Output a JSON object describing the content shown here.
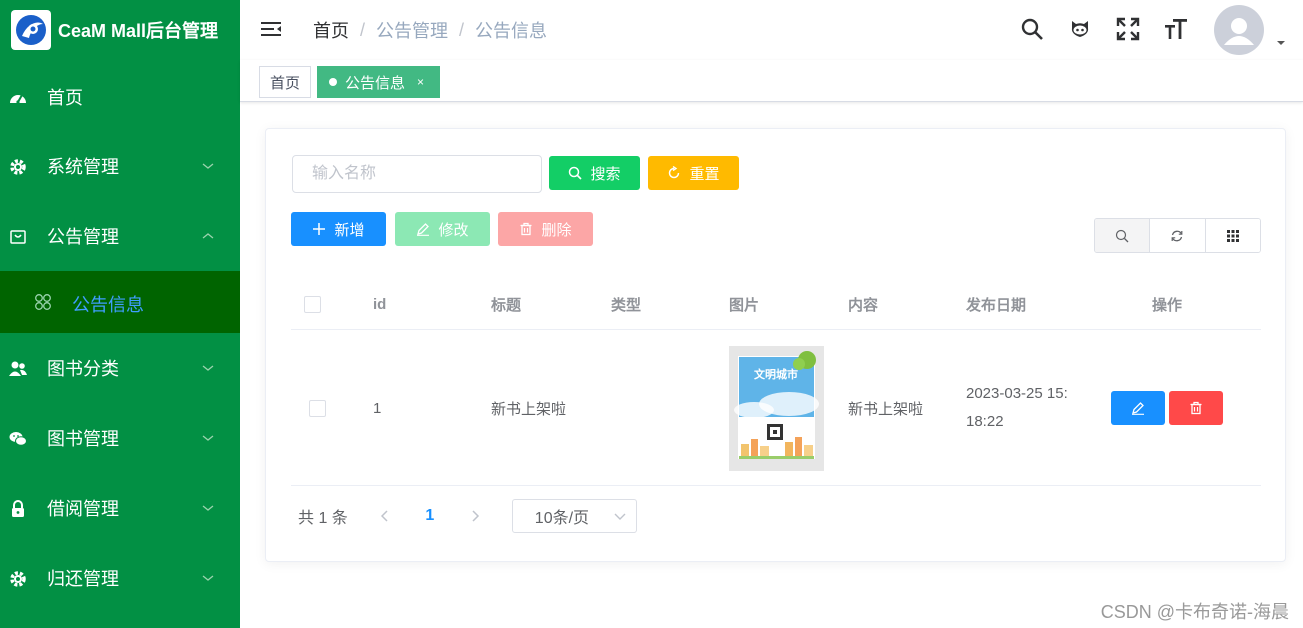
{
  "app": {
    "title": "CeaM Mall后台管理"
  },
  "sidebar": {
    "items": [
      {
        "label": "首页",
        "icon": "dashboard-icon",
        "expandable": false
      },
      {
        "label": "系统管理",
        "icon": "gear-icon",
        "expandable": true
      },
      {
        "label": "公告管理",
        "icon": "notice-box-icon",
        "expandable": true,
        "expanded": true
      },
      {
        "label": "图书分类",
        "icon": "user-group-icon",
        "expandable": true
      },
      {
        "label": "图书管理",
        "icon": "wechat-icon",
        "expandable": true
      },
      {
        "label": "借阅管理",
        "icon": "lock-icon",
        "expandable": true
      },
      {
        "label": "归还管理",
        "icon": "gear-icon",
        "expandable": true
      }
    ],
    "sub_item": {
      "label": "公告信息",
      "icon": "grid-flower-icon"
    },
    "colors": {
      "background": "#029044",
      "active_background": "#006400",
      "active_text": "#409eff"
    }
  },
  "header": {
    "breadcrumb": [
      "首页",
      "公告管理",
      "公告信息"
    ],
    "icons": [
      "search-icon",
      "github-icon",
      "fullscreen-icon",
      "font-size-icon"
    ]
  },
  "tags": {
    "home": "首页",
    "active": "公告信息",
    "close": "×"
  },
  "search": {
    "placeholder": "输入名称",
    "value": "",
    "search_label": "搜索",
    "reset_label": "重置"
  },
  "toolbar": {
    "add_label": "新增",
    "edit_label": "修改",
    "delete_label": "删除"
  },
  "table": {
    "headers": [
      "id",
      "标题",
      "类型",
      "图片",
      "内容",
      "发布日期",
      "操作"
    ],
    "rows": [
      {
        "id": "1",
        "title": "新书上架啦",
        "type": "",
        "image_caption": "文明城市",
        "content": "新书上架啦",
        "date": "2023-03-25 15:18:22"
      }
    ]
  },
  "pagination": {
    "total": "共 1 条",
    "current_page": "1",
    "page_size": "10条/页"
  },
  "watermark": "CSDN @卡布奇诺-海晨",
  "colors": {
    "primary": "#1890ff",
    "success": "#13ce66",
    "warning": "#ffba00",
    "danger": "#ff4949",
    "tag_active": "#42b983"
  }
}
